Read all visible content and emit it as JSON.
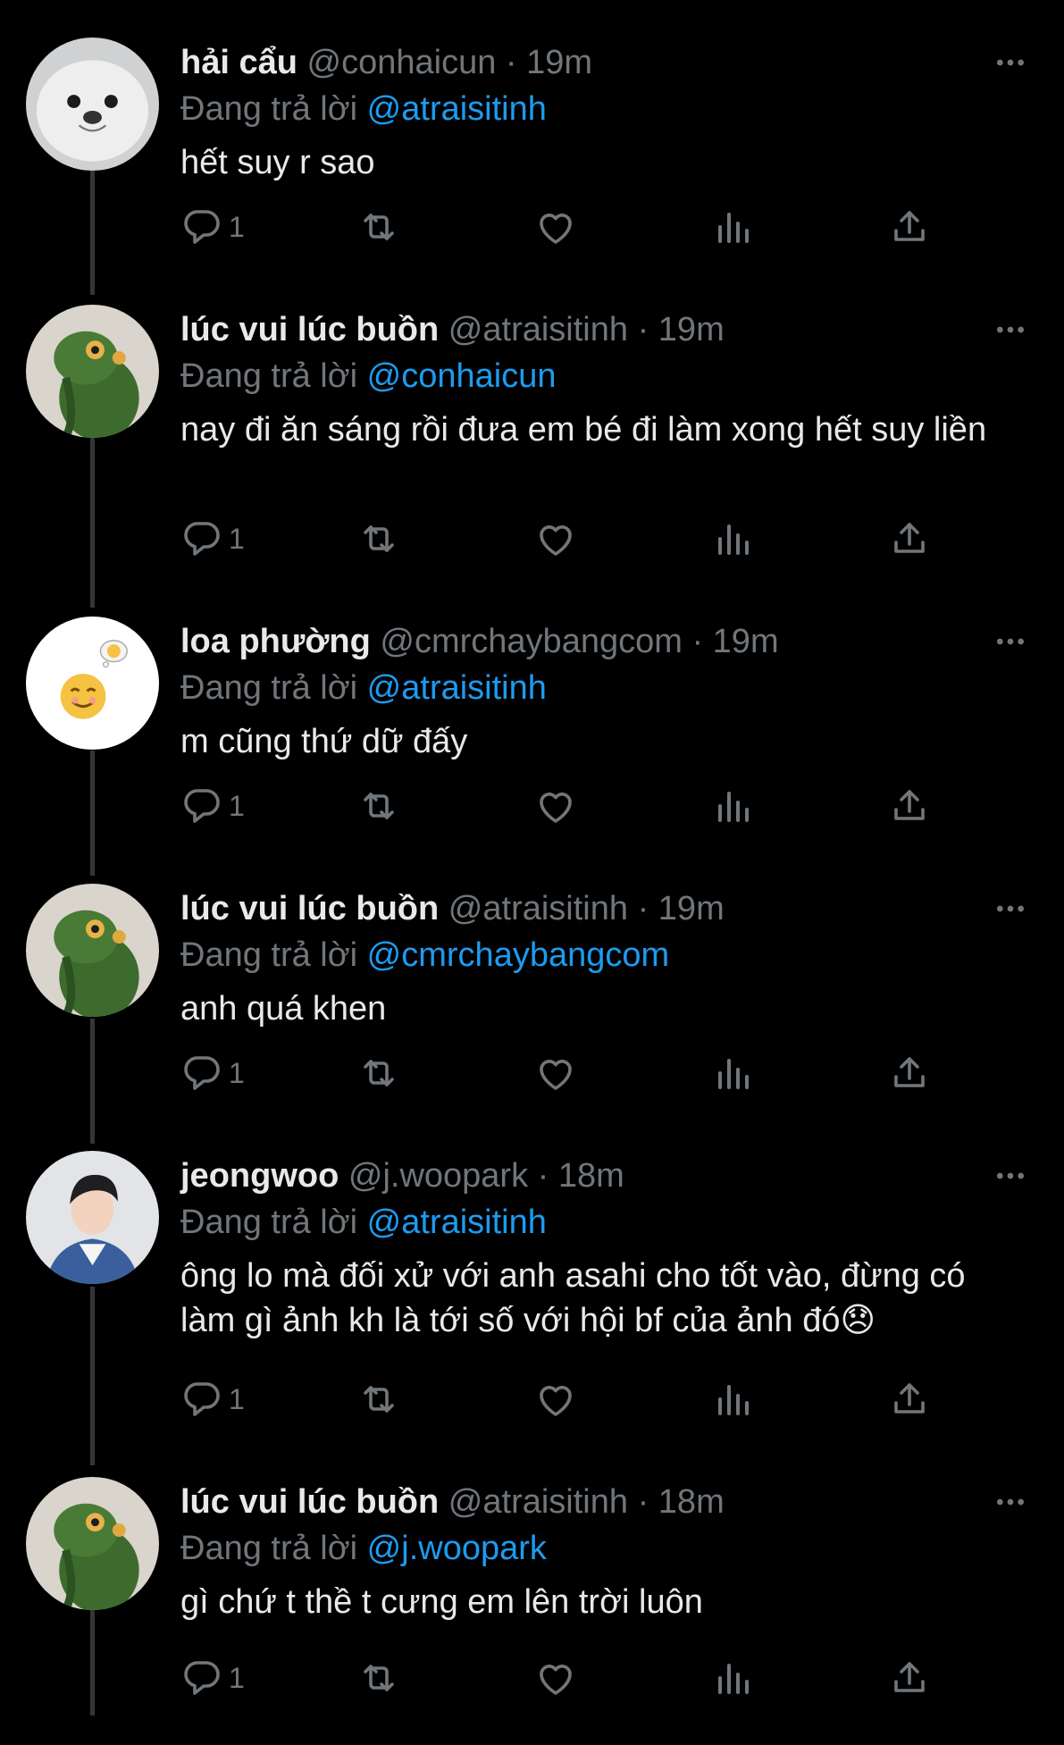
{
  "colors": {
    "background": "#000000",
    "text": "#e7e9ea",
    "secondary": "#71767b",
    "mention": "#1d9bf0",
    "thread_line": "#333639"
  },
  "replying_label": "Đang trả lời",
  "tweets": [
    {
      "avatar": "seal-avatar",
      "display_name": "hải cẩu",
      "handle": "@conhaicun",
      "separator": "·",
      "time": "19m",
      "reply_to": "@atraisitinh",
      "text": "hết suy r sao",
      "reply_count": "1"
    },
    {
      "avatar": "green-plush-frog-avatar",
      "display_name": "lúc vui lúc buồn",
      "handle": "@atraisitinh",
      "separator": "·",
      "time": "19m",
      "reply_to": "@conhaicun",
      "text": "nay đi ăn sáng rồi đưa em bé đi làm xong hết suy liền",
      "reply_count": "1"
    },
    {
      "avatar": "smiley-avatar",
      "display_name": "loa phường",
      "handle": "@cmrchaybangcom",
      "separator": "·",
      "time": "19m",
      "reply_to": "@atraisitinh",
      "text": "m cũng thứ dữ đấy",
      "reply_count": "1"
    },
    {
      "avatar": "green-plush-frog-avatar",
      "display_name": "lúc vui lúc buồn",
      "handle": "@atraisitinh",
      "separator": "·",
      "time": "19m",
      "reply_to": "@cmrchaybangcom",
      "text": "anh quá khen",
      "reply_count": "1"
    },
    {
      "avatar": "person-photo-avatar",
      "display_name": "jeongwoo",
      "handle": "@j.woopark",
      "separator": "·",
      "time": "18m",
      "reply_to": "@atraisitinh",
      "text": "ông lo mà đối xử với anh asahi cho tốt vào, đừng có làm gì ảnh kh là tới số với hội bf của ảnh đó😞",
      "reply_count": "1"
    },
    {
      "avatar": "green-plush-frog-avatar",
      "display_name": "lúc vui lúc buồn",
      "handle": "@atraisitinh",
      "separator": "·",
      "time": "18m",
      "reply_to": "@j.woopark",
      "text": "gì chứ t thề t cưng em lên trời luôn",
      "reply_count": "1"
    }
  ]
}
